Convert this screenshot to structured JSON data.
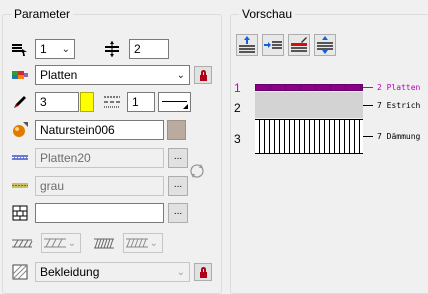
{
  "parameter": {
    "title": "Parameter",
    "row1": {
      "layer_value": "1",
      "height_value": "2"
    },
    "material": {
      "value": "Platten"
    },
    "pen": {
      "thickness_value": "3",
      "line_value": "1",
      "color": "#ffff00"
    },
    "surface": {
      "value": "Naturstein006"
    },
    "hatch": {
      "value": "Platten20"
    },
    "fill": {
      "value": "grau"
    },
    "pattern": {
      "value": ""
    },
    "ellipsis_label": "...",
    "bottom": {
      "value": "Bekleidung"
    }
  },
  "vorschau": {
    "title": "Vorschau",
    "layers": [
      {
        "left": "1",
        "right_num": "2",
        "right_name": "Platten",
        "color": "#8b008b",
        "left_color": "#c000c0",
        "right_color": "#c000c0"
      },
      {
        "left": "2",
        "right_num": "7",
        "right_name": "Estrich",
        "color": "#d3d3d3",
        "left_color": "#000000",
        "right_color": "#000000"
      },
      {
        "left": "3",
        "right_num": "7",
        "right_name": "Dämmung",
        "color": "#ffffff",
        "left_color": "#000000",
        "right_color": "#000000"
      }
    ]
  },
  "colors": {
    "lock_red": "#b00018",
    "accent_purple": "#c000c0"
  }
}
